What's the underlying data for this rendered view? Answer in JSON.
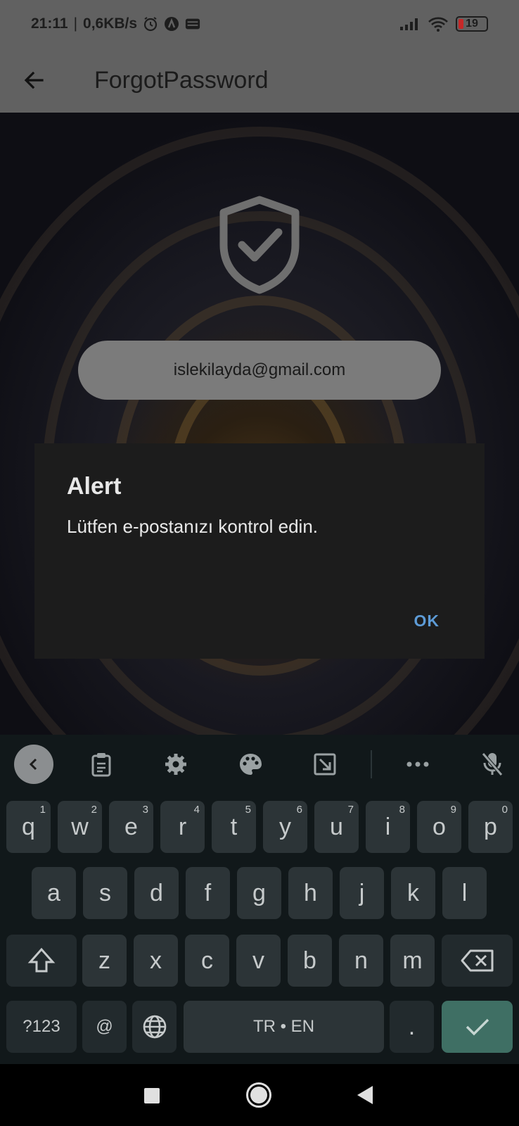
{
  "status_bar": {
    "time": "21:11",
    "net_speed": "0,6KB/s",
    "battery_level": "19",
    "icons": [
      "alarm-icon",
      "app-a-icon",
      "webtoon-icon",
      "signal-icon",
      "wifi-icon",
      "battery-icon"
    ]
  },
  "app_bar": {
    "back_icon": "arrow-back-icon",
    "title": "ForgotPassword"
  },
  "content": {
    "shield_icon": "shield-check-icon",
    "email_value": "islekilayda@gmail.com"
  },
  "dialog": {
    "title": "Alert",
    "message": "Lütfen e-postanızı kontrol edin.",
    "ok_label": "OK"
  },
  "keyboard": {
    "toolbar_icons": [
      "chevron-left-icon",
      "clipboard-icon",
      "settings-icon",
      "palette-icon",
      "resize-icon",
      "more-icon",
      "mic-off-icon"
    ],
    "row1": [
      {
        "k": "q",
        "n": "1"
      },
      {
        "k": "w",
        "n": "2"
      },
      {
        "k": "e",
        "n": "3"
      },
      {
        "k": "r",
        "n": "4"
      },
      {
        "k": "t",
        "n": "5"
      },
      {
        "k": "y",
        "n": "6"
      },
      {
        "k": "u",
        "n": "7"
      },
      {
        "k": "i",
        "n": "8"
      },
      {
        "k": "o",
        "n": "9"
      },
      {
        "k": "p",
        "n": "0"
      }
    ],
    "row2": [
      "a",
      "s",
      "d",
      "f",
      "g",
      "h",
      "j",
      "k",
      "l"
    ],
    "row3": [
      "z",
      "x",
      "c",
      "v",
      "b",
      "n",
      "m"
    ],
    "symbols_label": "?123",
    "at_label": "@",
    "space_label": "TR • EN",
    "period_label": "."
  },
  "colors": {
    "accent": "#5d9bd6",
    "enter_key": "#3f6f64"
  }
}
